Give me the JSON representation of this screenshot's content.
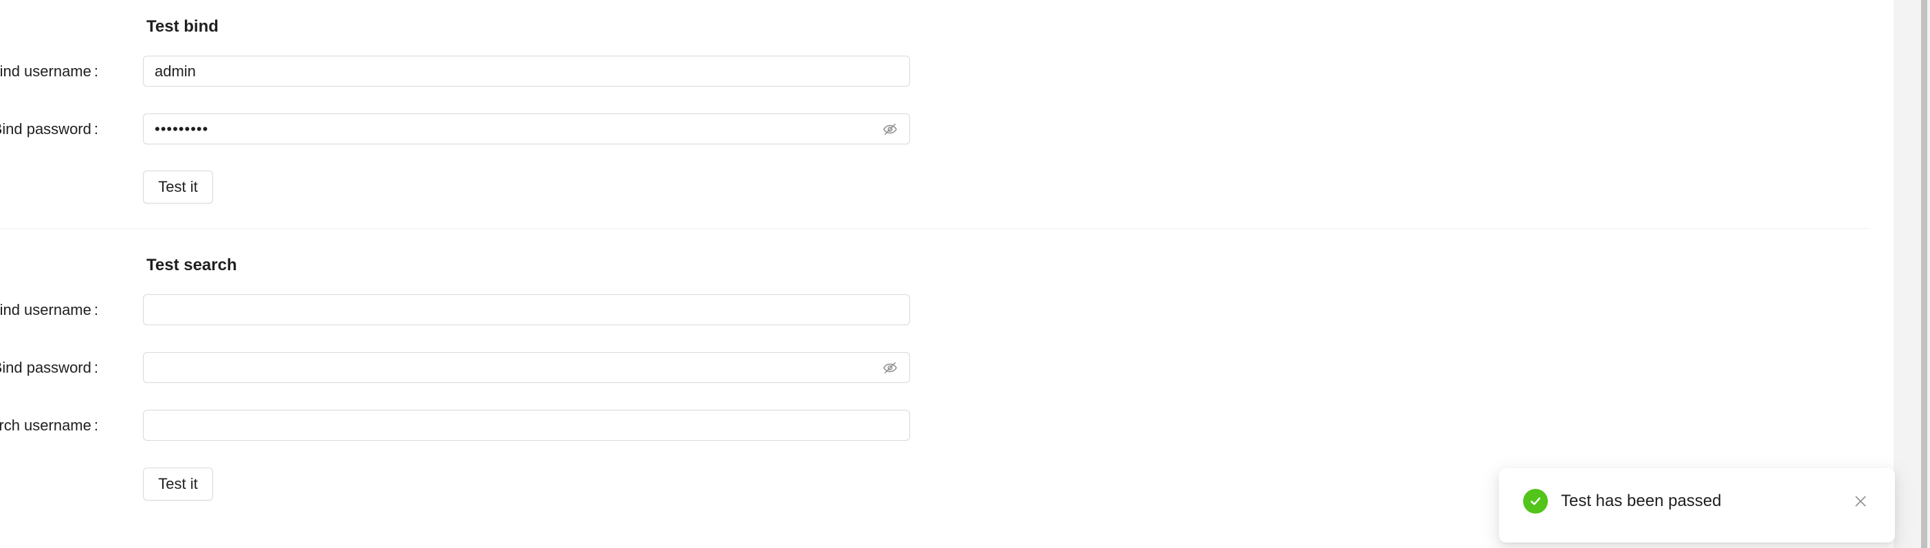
{
  "test_bind": {
    "title": "Test bind",
    "username_label": "Bind username",
    "username_value": "admin",
    "password_label": "Bind password",
    "password_value": "•••••••••",
    "button_label": "Test it"
  },
  "test_search": {
    "title": "Test search",
    "username_label": "Bind username",
    "username_value": "",
    "password_label": "Bind password",
    "password_value": "",
    "search_label": "Search username",
    "search_value": "",
    "button_label": "Test it"
  },
  "form": {
    "required_mark": "*",
    "colon": ":"
  },
  "toast": {
    "message": "Test has been passed",
    "status": "success",
    "status_color": "#52c41a",
    "icon": "check-circle-icon",
    "close_icon": "close-icon"
  },
  "icons": {
    "password_toggle": "eye-invisible-icon"
  }
}
